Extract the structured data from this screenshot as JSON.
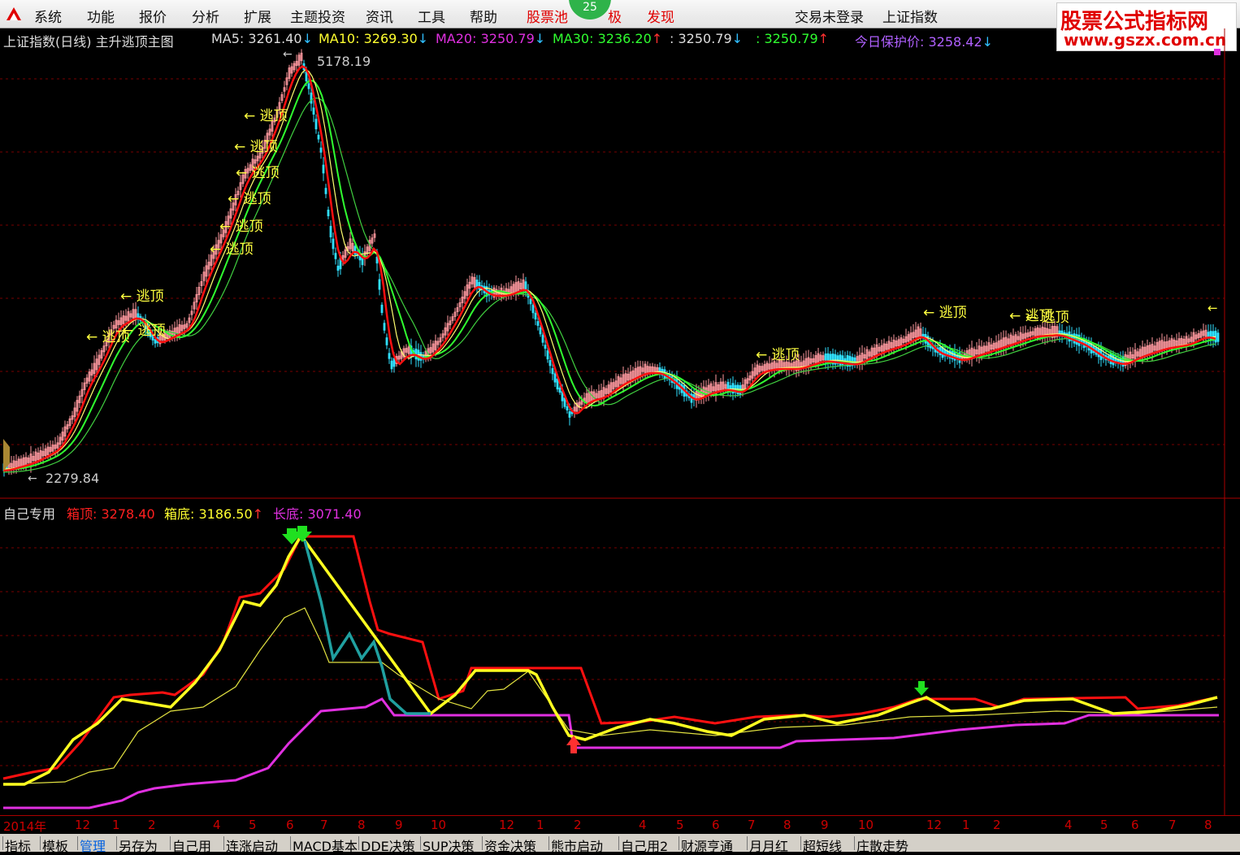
{
  "menu": {
    "items": [
      "系统",
      "功能",
      "报价",
      "分析",
      "扩展",
      "主题投资",
      "资讯",
      "工具",
      "帮助"
    ],
    "stock_pool": "股票池",
    "badge_count": "25",
    "hidden_item": "极",
    "discover": "发现",
    "login_status": "交易未登录",
    "index_name": "上证指数"
  },
  "watermark": {
    "line1": "股票公式指标网",
    "line2": "www.gszx.com.cn"
  },
  "main_panel": {
    "title": "上证指数(日线) 主升逃顶主图",
    "ma5": "MA5: 3261.40",
    "ma10": "MA10: 3269.30",
    "ma20": "MA20: 3250.79",
    "ma30": "MA30: 3236.20",
    "v1": ": 3250.79",
    "v2": ": 3250.79",
    "protect": "今日保护价: 3258.42",
    "high_label": "5178.19",
    "low_label": "2279.84",
    "escape_label": "逃顶"
  },
  "sub_panel": {
    "title": "自己专用",
    "box_top": "箱顶: 3278.40",
    "box_bottom": "箱底: 3186.50",
    "long_bottom": "长底: 3071.40"
  },
  "time_axis": [
    "2014年",
    "12",
    "1",
    "2",
    "4",
    "5",
    "6",
    "7",
    "8",
    "9",
    "10",
    "12",
    "1",
    "2",
    "4",
    "5",
    "6",
    "7",
    "8",
    "9",
    "10",
    "12",
    "1",
    "2",
    "4",
    "5",
    "6",
    "7",
    "8"
  ],
  "tabs": [
    "指标",
    "模板",
    "管理",
    "另存为",
    "自己用",
    "连涨启动",
    "MACD基本",
    "DDE决策",
    "SUP决策",
    "资金决策",
    "熊市启动",
    "自己用2",
    "财源亨通",
    "月月红",
    "超短线",
    "庄散走势"
  ],
  "active_tab": "管理",
  "colors": {
    "red": "#ff2020",
    "yellow": "#ffff30",
    "magenta": "#e030e0",
    "green": "#30ff30",
    "cyan": "#30e0ff",
    "pink": "#ff9090"
  }
}
